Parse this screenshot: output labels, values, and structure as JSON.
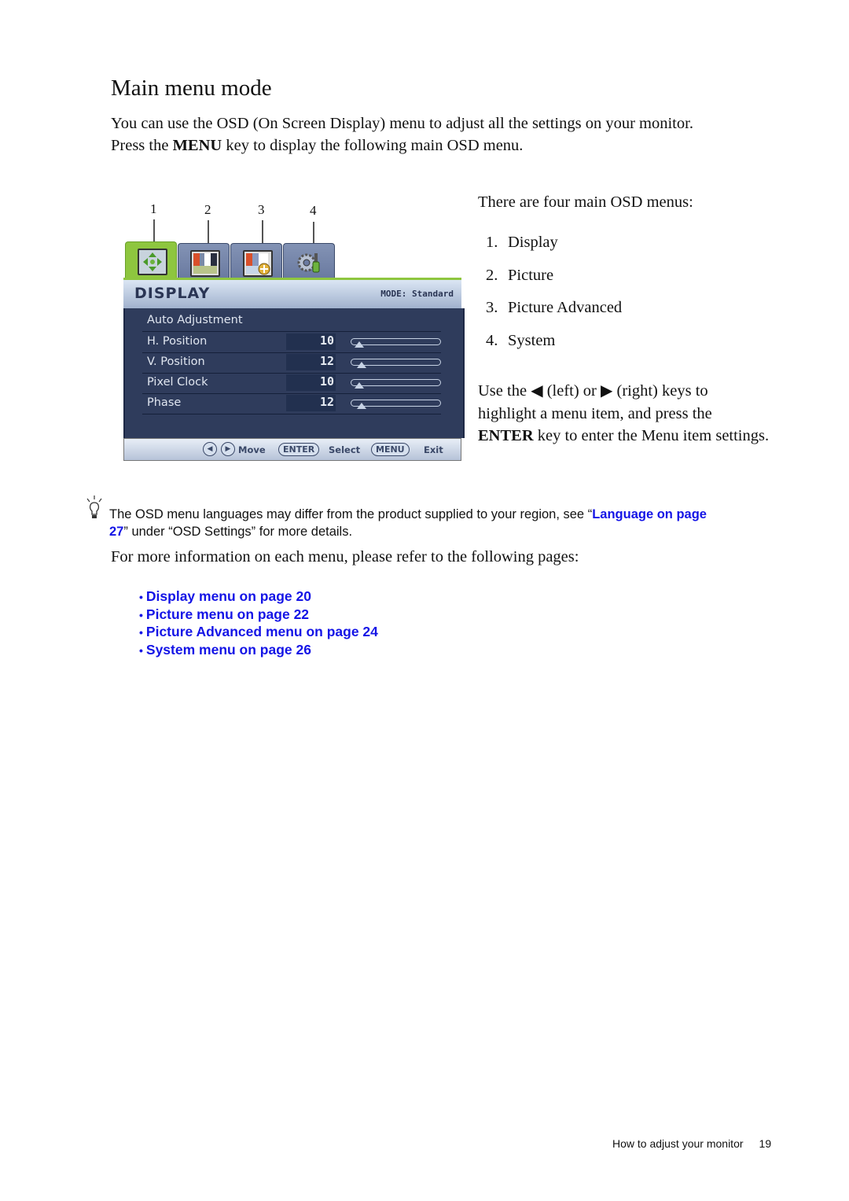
{
  "heading": "Main menu mode",
  "intro": {
    "line1": "You can use the OSD (On Screen Display) menu to adjust all the settings on your monitor.",
    "line2_pre": "Press the ",
    "line2_key": "MENU",
    "line2_post": " key to display the following main OSD menu."
  },
  "callouts": [
    "1",
    "2",
    "3",
    "4"
  ],
  "osd": {
    "tabs": [
      {
        "name": "Display",
        "icon": "display-arrows-icon",
        "active": true
      },
      {
        "name": "Picture",
        "icon": "picture-colorbars-icon",
        "active": false
      },
      {
        "name": "Picture Advanced",
        "icon": "picture-advanced-icon",
        "active": false
      },
      {
        "name": "System",
        "icon": "system-gear-icon",
        "active": false
      }
    ],
    "title": "DISPLAY",
    "mode": "MODE: Standard",
    "rows": [
      {
        "label": "Auto Adjustment"
      },
      {
        "label": "H. Position",
        "value": "10",
        "level": 0.1
      },
      {
        "label": "V. Position",
        "value": "12",
        "level": 0.12
      },
      {
        "label": "Pixel Clock",
        "value": "10",
        "level": 0.1
      },
      {
        "label": "Phase",
        "value": "12",
        "level": 0.12
      }
    ],
    "footer": {
      "left_key": "◀",
      "right_key": "▶",
      "move": "Move",
      "enter_key": "ENTER",
      "select": "Select",
      "menu_key": "MENU",
      "exit": "Exit"
    },
    "colors": {
      "active_tab": "#8ec63f",
      "body": "#2f3c5c",
      "header": "#c3d0e4"
    }
  },
  "right": {
    "intro": "There are four main OSD menus:",
    "menus": [
      {
        "num": "1.",
        "label": "Display"
      },
      {
        "num": "2.",
        "label": "Picture"
      },
      {
        "num": "3.",
        "label": "Picture Advanced"
      },
      {
        "num": "4.",
        "label": "System"
      }
    ],
    "keys": {
      "pre": "Use the ",
      "left_glyph": "◀",
      "left_text": " (left) or ",
      "right_glyph": "▶",
      "right_text": " (right) keys to",
      "line2": "highlight a menu item, and press the",
      "enter": "ENTER",
      "line3_post": " key to enter the Menu item settings."
    }
  },
  "note": {
    "text_pre": "The OSD menu languages may differ from the product supplied to your region, see “",
    "link_a": "Language on page",
    "link_b": "27",
    "text_post": "” under “OSD Settings” for more details."
  },
  "more_info": "For more information on each menu, please refer to the following pages:",
  "links": [
    {
      "bullet": "•",
      "label": "Display menu on page 20"
    },
    {
      "bullet": "•",
      "label": "Picture menu on page 22"
    },
    {
      "bullet": "•",
      "label": "Picture Advanced menu on page 24"
    },
    {
      "bullet": "•",
      "label": "System menu on page 26"
    }
  ],
  "link_color": "#1414e6",
  "footer": {
    "section": "How to adjust your monitor",
    "page": "19"
  }
}
